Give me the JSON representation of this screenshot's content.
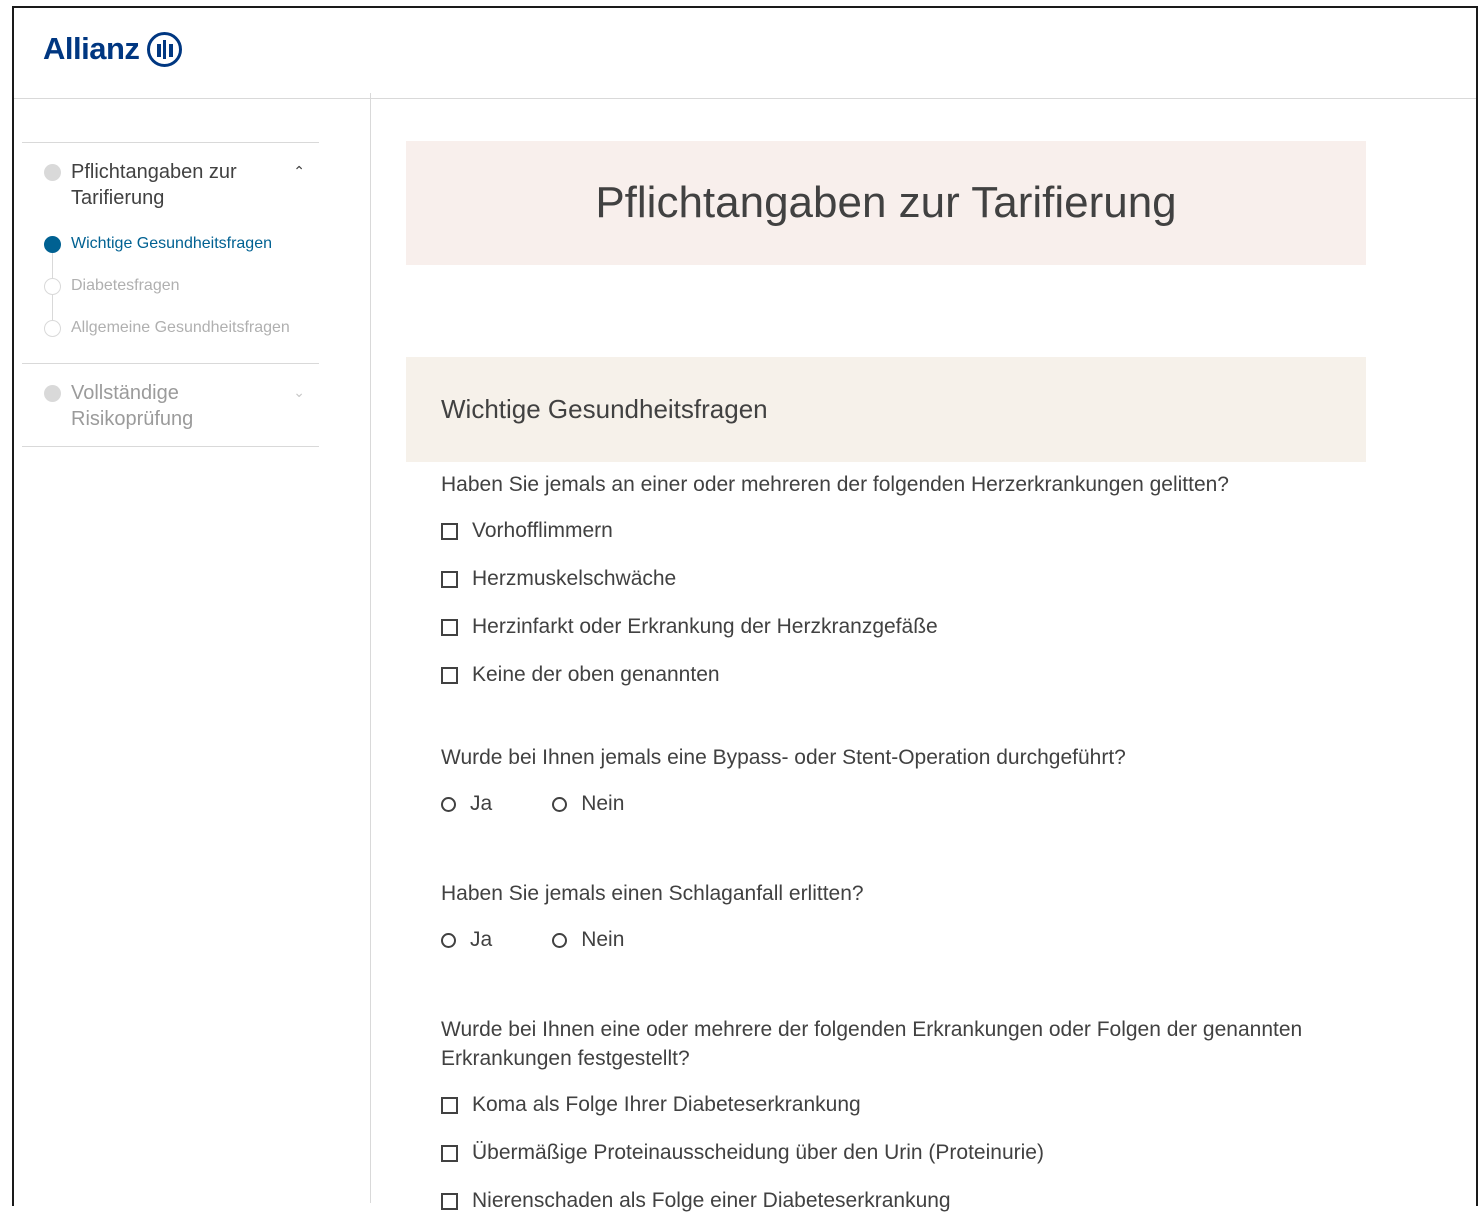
{
  "header": {
    "logo_text": "Allianz"
  },
  "sidebar": {
    "sections": [
      {
        "title": "Pflichtangaben zur Tarifierung",
        "expanded": true,
        "steps": [
          {
            "label": "Wichtige Gesundheitsfragen",
            "active": true
          },
          {
            "label": "Diabetesfragen",
            "active": false
          },
          {
            "label": "Allgemeine Gesundheitsfragen",
            "active": false
          }
        ]
      },
      {
        "title": "Vollständige Risikoprüfung",
        "expanded": false
      }
    ]
  },
  "main": {
    "hero_title": "Pflichtangaben zur Tarifierung",
    "section_title": "Wichtige Gesundheitsfragen",
    "questions": [
      {
        "text": "Haben Sie jemals an einer oder mehreren der folgenden Herzerkrankungen gelitten?",
        "options": [
          "Vorhofflimmern",
          "Herzmuskelschwäche",
          "Herzinfarkt oder Erkrankung der Herzkranzgefäße",
          "Keine der oben genannten"
        ]
      },
      {
        "text": "Wurde bei Ihnen jemals eine Bypass- oder Stent-Operation durchgeführt?",
        "radio": [
          "Ja",
          "Nein"
        ]
      },
      {
        "text": "Haben Sie jemals einen Schlaganfall erlitten?",
        "radio": [
          "Ja",
          "Nein"
        ]
      },
      {
        "text": "Wurde bei Ihnen eine oder mehrere der folgenden Erkrankungen oder Folgen der genannten Erkrankungen festgestellt?",
        "options": [
          "Koma als Folge Ihrer Diabeteserkrankung",
          "Übermäßige Proteinausscheidung über den Urin (Proteinurie)",
          "Nierenschaden als Folge einer Diabeteserkrankung"
        ]
      }
    ]
  },
  "colors": {
    "brand": "#003781",
    "active": "#006192",
    "hero_bg": "#f8efec",
    "section_bg": "#f6f1ea"
  }
}
